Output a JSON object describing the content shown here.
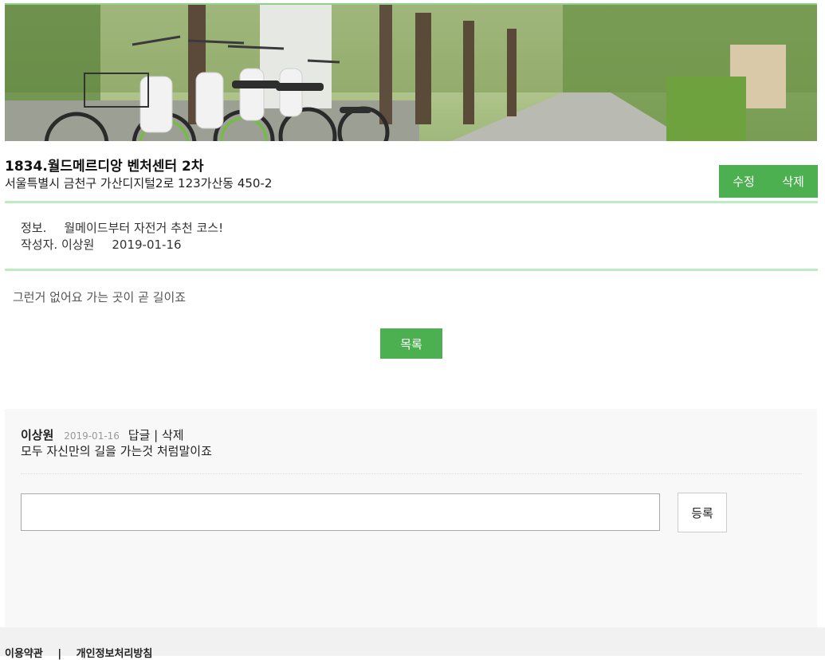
{
  "place": {
    "name": "1834.월드메르디앙 벤처센터 2차",
    "address": "서울특별시 금천구 가산디지털2로 123가산동 450-2"
  },
  "actions": {
    "edit_label": "수정",
    "delete_label": "삭제"
  },
  "post": {
    "info_label": "정보.",
    "info_value": "월메이드부터 자전거 추천 코스!",
    "author_label": "작성자.",
    "author": "이상원",
    "date": "2019-01-16",
    "content": "그런거 없어요 가는 곳이 곧 길이죠"
  },
  "list_button": "목록",
  "comments": [
    {
      "author": "이상원",
      "date": "2019-01-16",
      "reply_label": "답글",
      "separator": "|",
      "delete_label": "삭제",
      "text": "모두 자신만의 길을 가는것 처럼말이죠"
    }
  ],
  "comment_form": {
    "input_value": "",
    "submit_label": "등록"
  },
  "footer": {
    "terms": "이용약관",
    "separator": "|",
    "privacy": "개인정보처리방침"
  },
  "colors": {
    "accent": "#4caf50",
    "divider": "#b8eec0",
    "comment_bg": "#f8f8f8",
    "footer_bg": "#f1f1f1"
  },
  "hero_image": "bike-rental-station-photo"
}
